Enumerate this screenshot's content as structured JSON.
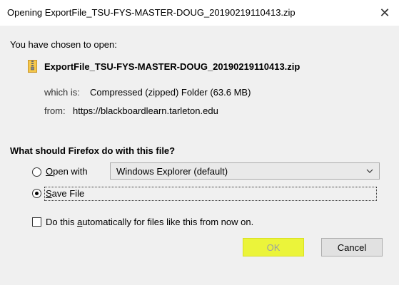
{
  "window": {
    "title": "Opening ExportFile_TSU-FYS-MASTER-DOUG_20190219110413.zip",
    "close_glyph": "✕"
  },
  "file": {
    "intro": "You have chosen to open:",
    "name": "ExportFile_TSU-FYS-MASTER-DOUG_20190219110413.zip",
    "icon": "zip-file-icon",
    "which_is_label": "which is:",
    "type": "Compressed (zipped) Folder (63.6 MB)",
    "from_label": "from:",
    "source": "https://blackboardlearn.tarleton.edu"
  },
  "action": {
    "question": "What should Firefox do with this file?",
    "open_with": {
      "mnemonic": "O",
      "rest": "pen with",
      "selected": false,
      "app": "Windows Explorer (default)"
    },
    "save_file": {
      "mnemonic": "S",
      "rest": "ave File",
      "selected": true
    },
    "auto": {
      "before": "Do this ",
      "mnemonic": "a",
      "after": "utomatically for files like this from now on.",
      "checked": false
    }
  },
  "buttons": {
    "ok": "OK",
    "cancel": "Cancel",
    "ok_highlight": "#ebf43a"
  }
}
